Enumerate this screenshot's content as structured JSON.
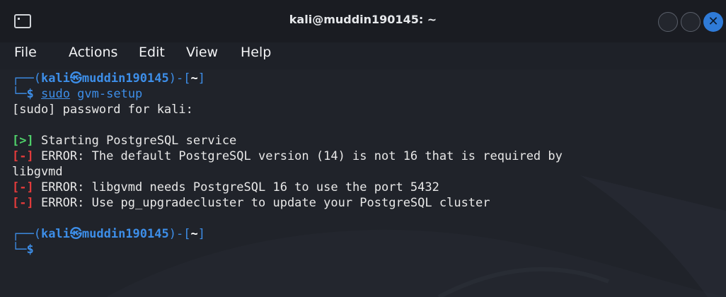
{
  "window": {
    "title": "kali@muddin190145: ~",
    "icon": "terminal-icon",
    "close_glyph": "✕"
  },
  "menu": {
    "file": "File",
    "actions": "Actions",
    "edit": "Edit",
    "view": "View",
    "help": "Help"
  },
  "prompt": {
    "corner_top": "┌──(",
    "user": "kali",
    "at": "㉿",
    "host": "muddin190145",
    "bracket_mid": ")-[",
    "dir": "~",
    "bracket_end": "]",
    "corner_bottom": "└─",
    "dollar": "$"
  },
  "command": {
    "sudo": "sudo",
    "rest": " gvm-setup"
  },
  "output": {
    "password": "[sudo] password for kali:",
    "ok_tag": "[>]",
    "ok_text": " Starting PostgreSQL service",
    "err_tag": "[-]",
    "err1_text": " ERROR: The default PostgreSQL version (14) is not 16 that is required by",
    "err1_wrap": "libgvmd",
    "err2_text": " ERROR: libgvmd needs PostgreSQL 16 to use the port 5432",
    "err3_text": " ERROR: Use pg_upgradecluster to update your PostgreSQL cluster"
  },
  "colors": {
    "prompt_blue": "#3d8ee8",
    "ok_green": "#4fd06a",
    "error_red": "#e23b3b",
    "text": "#e8e8e8",
    "background": "#20232a",
    "close_button": "#2f7bd8"
  }
}
